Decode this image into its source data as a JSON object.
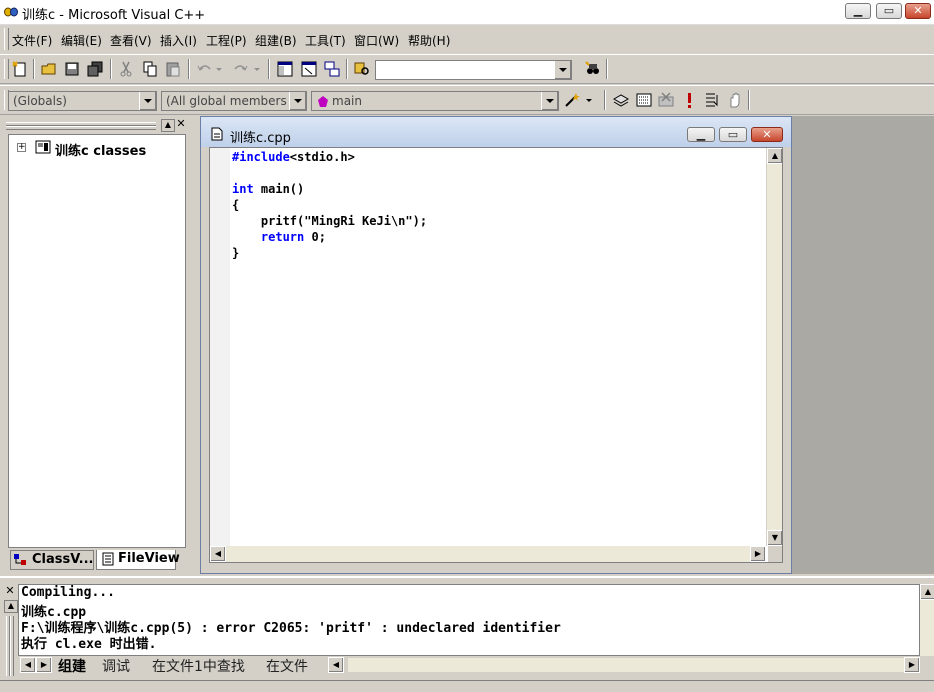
{
  "window": {
    "title": "训练c - Microsoft Visual C++"
  },
  "menu": [
    "文件(F)",
    "编辑(E)",
    "查看(V)",
    "插入(I)",
    "工程(P)",
    "组建(B)",
    "工具(T)",
    "窗口(W)",
    "帮助(H)"
  ],
  "toolbar2": {
    "globals_combo": "(Globals)",
    "members_combo": "(All global members",
    "function_combo": "main"
  },
  "workspace": {
    "tree_root": "训练c classes",
    "tabs": [
      "ClassV...",
      "FileView"
    ]
  },
  "editor": {
    "title": "训练c.cpp",
    "lines": [
      {
        "kw": "#include",
        "rest": "<stdio.h>"
      },
      {
        "kw": "",
        "rest": ""
      },
      {
        "kw": "int",
        "rest": " main()"
      },
      {
        "kw": "",
        "rest": "{"
      },
      {
        "kw": "",
        "rest": "    pritf(\"MingRi KeJi\\n\");"
      },
      {
        "kw": "    return",
        "rest": " 0;"
      },
      {
        "kw": "",
        "rest": "}"
      }
    ]
  },
  "output": {
    "lines": [
      "Compiling...",
      "训练c.cpp",
      "F:\\训练程序\\训练c.cpp(5) : error C2065: 'pritf' : undeclared identifier",
      "执行 cl.exe 时出错."
    ],
    "tabs": [
      "组建",
      "调试",
      "在文件1中查找",
      "在文件"
    ]
  },
  "colors": {
    "keyword": "#0000ff",
    "mdi_background": "#aba9a4",
    "chrome": "#d4d0c8"
  }
}
